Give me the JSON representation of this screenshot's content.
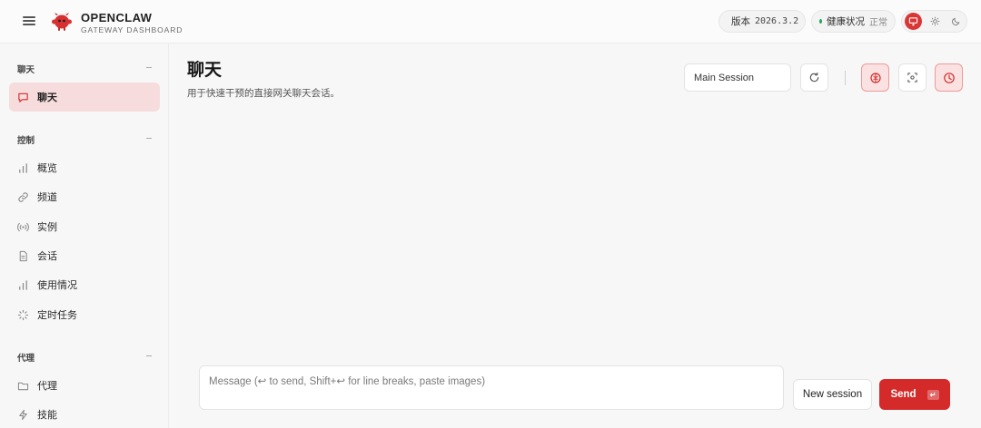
{
  "app": {
    "brand_title": "OPENCLAW",
    "brand_subtitle": "GATEWAY DASHBOARD",
    "accent_color": "#d42a2a",
    "status_color": "#1ea35b"
  },
  "header": {
    "version_label": "版本",
    "version_value": "2026.3.2",
    "health_label": "健康状况",
    "health_value": "正常",
    "theme_icons": [
      "monitor-icon",
      "sun-icon",
      "moon-icon"
    ]
  },
  "sidebar": {
    "sections": [
      {
        "title": "聊天",
        "items": [
          {
            "label": "聊天",
            "icon": "chat-bubble-icon",
            "active": true
          }
        ]
      },
      {
        "title": "控制",
        "items": [
          {
            "label": "概览",
            "icon": "bar-chart-icon"
          },
          {
            "label": "频道",
            "icon": "link-icon"
          },
          {
            "label": "实例",
            "icon": "broadcast-icon"
          },
          {
            "label": "会话",
            "icon": "document-icon"
          },
          {
            "label": "使用情况",
            "icon": "bar-chart-icon"
          },
          {
            "label": "定时任务",
            "icon": "loader-icon"
          }
        ]
      },
      {
        "title": "代理",
        "items": [
          {
            "label": "代理",
            "icon": "folder-icon"
          },
          {
            "label": "技能",
            "icon": "lightning-icon"
          }
        ]
      }
    ]
  },
  "main": {
    "title": "聊天",
    "subtitle": "用于快速干预的直接网关聊天会话。",
    "session_select": "Main Session",
    "toolbar_icons": [
      "refresh-icon",
      "brain-icon",
      "focus-icon",
      "clock-icon"
    ]
  },
  "composer": {
    "placeholder": "Message (↩ to send, Shift+↩ for line breaks, paste images)",
    "new_session_label": "New session",
    "send_label": "Send",
    "send_kbd": "↵"
  }
}
